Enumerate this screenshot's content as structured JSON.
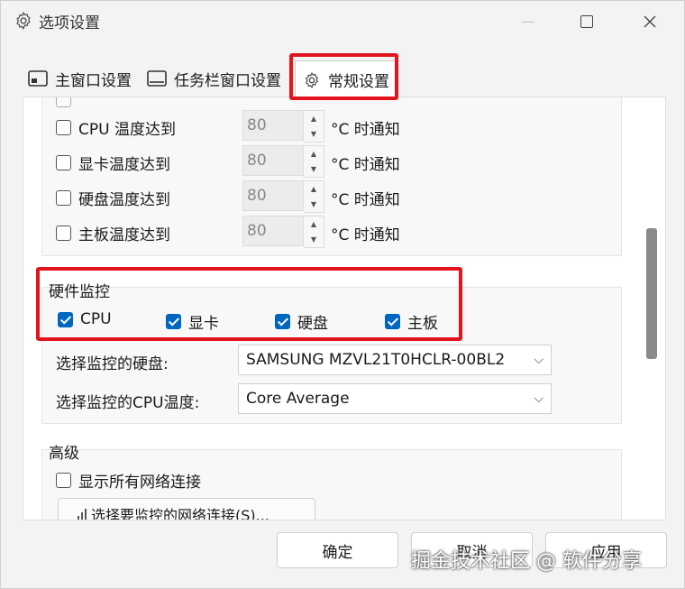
{
  "window": {
    "title": "选项设置",
    "title_icon": "gear-icon",
    "controls": [
      "minimize",
      "maximize",
      "close"
    ]
  },
  "tabs": [
    {
      "label": "主窗口设置",
      "icon": "window-icon"
    },
    {
      "label": "任务栏窗口设置",
      "icon": "taskbar-icon"
    },
    {
      "label": "常规设置",
      "icon": "gear-icon",
      "active": true
    }
  ],
  "temperature": {
    "rows": [
      {
        "label": "CPU 温度达到",
        "value": "80",
        "unit": "°C 时通知",
        "checked": false
      },
      {
        "label": "显卡温度达到",
        "value": "80",
        "unit": "°C 时通知",
        "checked": false
      },
      {
        "label": "硬盘温度达到",
        "value": "80",
        "unit": "°C 时通知",
        "checked": false
      },
      {
        "label": "主板温度达到",
        "value": "80",
        "unit": "°C 时通知",
        "checked": false
      }
    ]
  },
  "hardware": {
    "title": "硬件监控",
    "items": [
      {
        "label": "CPU",
        "checked": true
      },
      {
        "label": "显卡",
        "checked": true
      },
      {
        "label": "硬盘",
        "checked": true
      },
      {
        "label": "主板",
        "checked": true
      }
    ],
    "disk_label": "选择监控的硬盘:",
    "disk_value": "SAMSUNG MZVL21T0HCLR-00BL2",
    "cpu_temp_label": "选择监控的CPU温度:",
    "cpu_temp_value": "Core Average"
  },
  "advanced": {
    "title": "高级",
    "show_all_label": "显示所有网络连接",
    "select_button": "选择要监控的网络连接(S)..."
  },
  "footer": {
    "ok": "确定",
    "cancel": "取消",
    "apply": "应用"
  },
  "watermark": "掘金技术社区 @ 软件分享",
  "colors": {
    "accent": "#0067c0",
    "highlight": "#e3141e"
  }
}
